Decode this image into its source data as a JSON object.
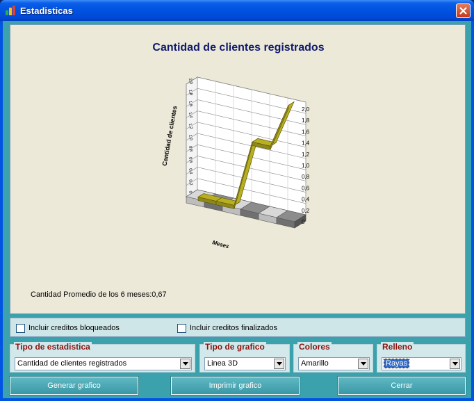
{
  "window": {
    "title": "Estadisticas"
  },
  "chart_data": {
    "type": "line",
    "title": "Cantidad de clientes registrados",
    "xlabel": "Meses",
    "ylabel": "Cantidad de clientes",
    "categories": [
      "",
      "",
      "",
      "",
      "",
      ""
    ],
    "values": [
      0,
      0,
      0,
      1.2,
      1.2,
      2.0
    ],
    "ylim": [
      0,
      2.0
    ],
    "yticks": [
      "0",
      "0,2",
      "0,4",
      "0,6",
      "0,8",
      "1,0",
      "1,2",
      "1,4",
      "1,6",
      "1,8",
      "2,0"
    ],
    "style": "3D",
    "line_color": "#b8b020"
  },
  "summary": {
    "average_text": "Cantidad Promedio de los 6 meses:0,67"
  },
  "options": {
    "include_blocked": "Incluir creditos bloqueados",
    "include_finished": "Incluir creditos finalizados"
  },
  "selectors": {
    "stat_type": {
      "label": "Tipo de estadistica",
      "value": "Cantidad de clientes registrados"
    },
    "chart_type": {
      "label": "Tipo de grafico",
      "value": "Linea 3D"
    },
    "colors": {
      "label": "Colores",
      "value": "Amarillo"
    },
    "fill": {
      "label": "Relleno",
      "value": "Rayas"
    }
  },
  "buttons": {
    "generate": "Generar grafico",
    "print": "Imprimir grafico",
    "close": "Cerrar"
  }
}
